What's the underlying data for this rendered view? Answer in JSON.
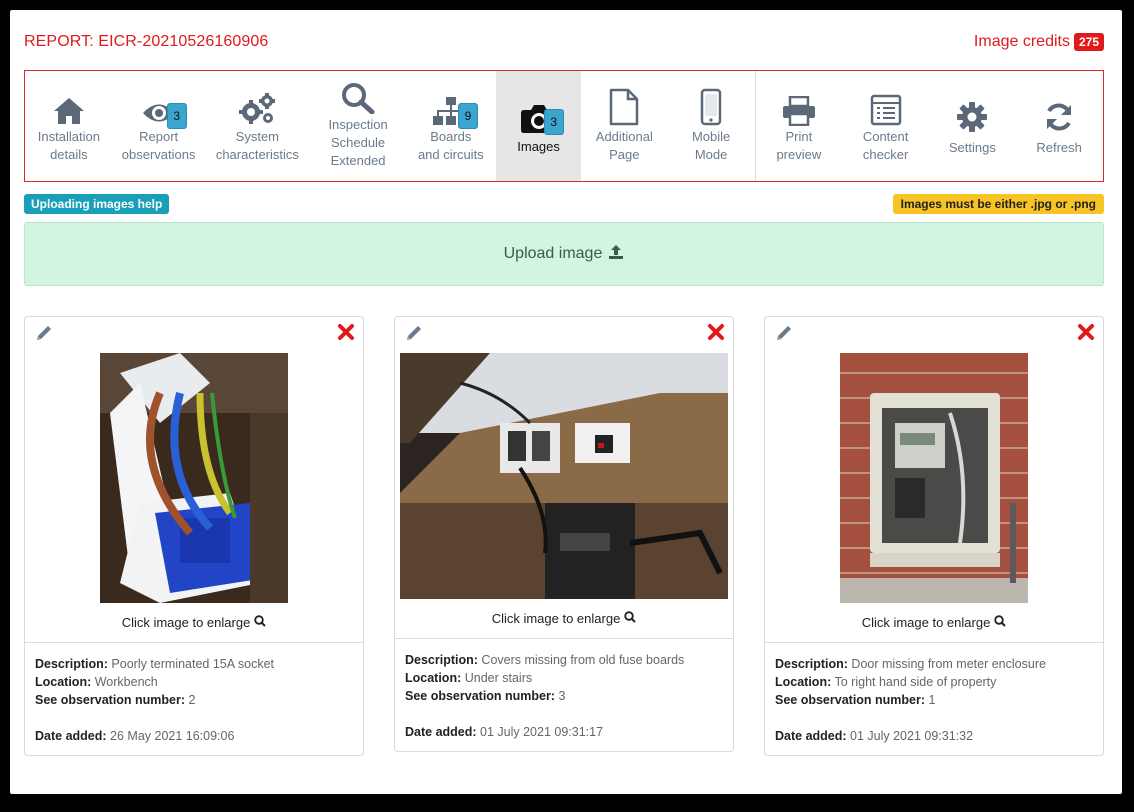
{
  "header": {
    "report_title": "REPORT: EICR-20210526160906",
    "credits_label": "Image credits",
    "credits_count": "275"
  },
  "toolbar": {
    "items": [
      {
        "line1": "Installation",
        "line2": "details",
        "icon": "home-icon"
      },
      {
        "line1": "Report",
        "line2": "observations",
        "icon": "eye-icon",
        "badge": "3"
      },
      {
        "line1": "System",
        "line2": "characteristics",
        "icon": "gears-icon"
      },
      {
        "line1": "Inspection",
        "line2": "Schedule",
        "line3": "Extended",
        "icon": "search-icon"
      },
      {
        "line1": "Boards",
        "line2": "and circuits",
        "icon": "sitemap-icon",
        "badge": "9"
      },
      {
        "line1": "Images",
        "icon": "camera-icon",
        "badge": "3"
      },
      {
        "line1": "Additional",
        "line2": "Page",
        "icon": "file-icon"
      },
      {
        "line1": "Mobile",
        "line2": "Mode",
        "icon": "mobile-icon"
      },
      {
        "line1": "Print",
        "line2": "preview",
        "icon": "print-icon"
      },
      {
        "line1": "Content",
        "line2": "checker",
        "icon": "checklist-icon"
      },
      {
        "line1": "Settings",
        "icon": "gear-icon"
      },
      {
        "line1": "Refresh",
        "icon": "refresh-icon"
      }
    ]
  },
  "help": {
    "help_label": "Uploading images help",
    "format_warning": "Images must be either .jpg or .png"
  },
  "upload": {
    "label": "Upload image"
  },
  "labels": {
    "enlarge": "Click image to enlarge",
    "description": "Description:",
    "location": "Location:",
    "observation": "See observation number:",
    "date": "Date added:"
  },
  "images": [
    {
      "description": "Poorly terminated 15A socket",
      "location": "Workbench",
      "observation": "2",
      "date": "26 May 2021 16:09:06"
    },
    {
      "description": "Covers missing from old fuse boards",
      "location": "Under stairs",
      "observation": "3",
      "date": "01 July 2021 09:31:17"
    },
    {
      "description": "Door missing from meter enclosure",
      "location": "To right hand side of property",
      "observation": "1",
      "date": "01 July 2021 09:31:32"
    }
  ],
  "colors": {
    "brand_red": "#e0191c",
    "badge_blue": "#3aa6d0",
    "help_teal": "#1a9fb8",
    "warning_yellow": "#f7c325",
    "upload_green": "#d2f5df"
  }
}
